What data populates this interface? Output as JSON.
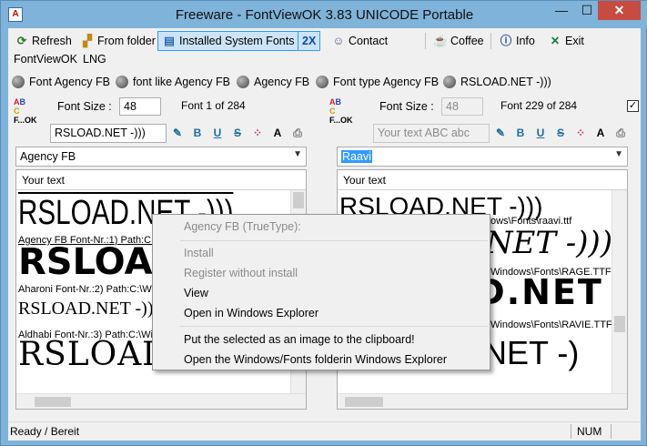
{
  "window": {
    "title": "Freeware - FontViewOK 3.83 UNICODE Portable",
    "min": "—",
    "max": "☐",
    "close": "✕"
  },
  "toolbar": {
    "refresh": "Refresh",
    "from_folder": "From folder",
    "installed": "Installed System Fonts",
    "twox": "2X",
    "contact": "Contact",
    "coffee": "Coffee",
    "info": "Info",
    "exit": "Exit"
  },
  "menu": [
    "FontViewOK",
    "LNG"
  ],
  "font_tabs": [
    "Font Agency FB",
    "font like Agency FB",
    "Agency FB",
    "Font type Agency FB",
    "RSLOAD.NET -)))"
  ],
  "left": {
    "font_size_label": "Font Size :",
    "font_size": "48",
    "font_count": "Font 1 of 284",
    "text_value": "RSLOAD.NET -)))",
    "font_combo": "Agency FB",
    "preview_header": "Your text",
    "samples": [
      {
        "text": "RSLOAD.NET -)))",
        "info": "Agency FB Font-Nr.:1) Path:C:\\W"
      },
      {
        "text": "RSLOAD.NET -)))",
        "info": "Aharoni Font-Nr.:2) Path:C:\\Wi"
      },
      {
        "text": "RSLOAD.NET -)))",
        "info": "Aldhabi Font-Nr.:3) Path:C:\\Wi"
      },
      {
        "text": "RSLOAD.NET -)))",
        "info": ""
      }
    ]
  },
  "right": {
    "font_size_label": "Font Size :",
    "font_size": "48",
    "font_count": "Font 229 of 284",
    "text_placeholder": "Your text ABC abc",
    "font_combo": "Raavi",
    "preview_header": "Your text",
    "checkbox": "✓",
    "samples": [
      {
        "text": "RSLOAD.NET -)))",
        "info": "ows\\Fonts\\raavi.ttf"
      },
      {
        "text": "RSLOAD.NET -)))",
        "info": "Windows\\Fonts\\RAGE.TTF"
      },
      {
        "text": "RSLOAD.NET",
        "info": "Windows\\Fonts\\RAVIE.TTF"
      },
      {
        "text": "RSLOAD.NET -)",
        "info": ""
      }
    ]
  },
  "format_icons": [
    "✎",
    "B",
    "U",
    "S",
    "⁘",
    "A"
  ],
  "context_menu": {
    "header": "Agency FB (TrueType):",
    "install": "Install",
    "register": "Register without install",
    "view": "View",
    "open_explorer": "Open in Windows Explorer",
    "put_clipboard": "Put the selected as an image to the clipboard!",
    "open_fonts_folder": "Open the Windows/Fonts folderin  Windows Explorer"
  },
  "status": {
    "text": "Ready / Bereit",
    "num": "NUM"
  }
}
